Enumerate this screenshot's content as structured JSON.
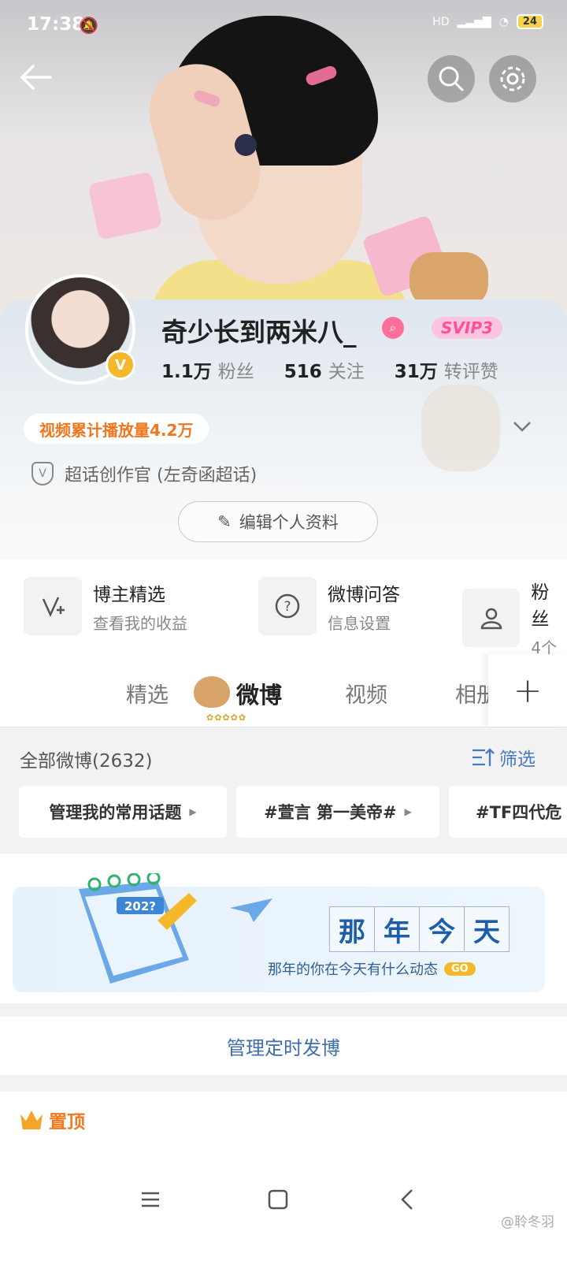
{
  "status_bar": {
    "time": "17:38",
    "network": "HD",
    "battery": "24"
  },
  "profile": {
    "username": "奇少长到两米八_",
    "vip_badge": "SVIP3",
    "verified_mark": "V",
    "stats": [
      {
        "value": "1.1万",
        "label": "粉丝"
      },
      {
        "value": "516",
        "label": "关注"
      },
      {
        "value": "31万",
        "label": "转评赞"
      }
    ],
    "play_count": "视频累计播放量4.2万",
    "super_topic": "超话创作官 (左奇函超话)",
    "edit_label": "编辑个人资料"
  },
  "features": [
    {
      "icon": "✓",
      "title": "博主精选",
      "sub": "查看我的收益"
    },
    {
      "icon": "?",
      "title": "微博问答",
      "sub": "信息设置"
    },
    {
      "icon": "👥",
      "title": "粉丝",
      "sub": "4个"
    }
  ],
  "tabs": [
    "精选",
    "微博",
    "视频",
    "相册"
  ],
  "tab_plus": "+",
  "flowers": "✿✿✿✿✿",
  "filter": {
    "all_label": "全部微博(2632)",
    "filter_label": "筛选",
    "chips": [
      "管理我的常用话题",
      "#萱言 第一美帝#",
      "#TF四代危"
    ]
  },
  "banner": {
    "chars": [
      "那",
      "年",
      "今",
      "天"
    ],
    "subtitle": "那年的你在今天有什么动态",
    "go": "GO",
    "cal_year": "202?"
  },
  "manage_label": "管理定时发博",
  "pinned_label": "置顶",
  "watermark": "@聆冬羽",
  "colors": {
    "accent_blue": "#3d6ea9",
    "accent_orange": "#f07a1e",
    "gold": "#f5b82a",
    "pink": "#ff4f99"
  }
}
